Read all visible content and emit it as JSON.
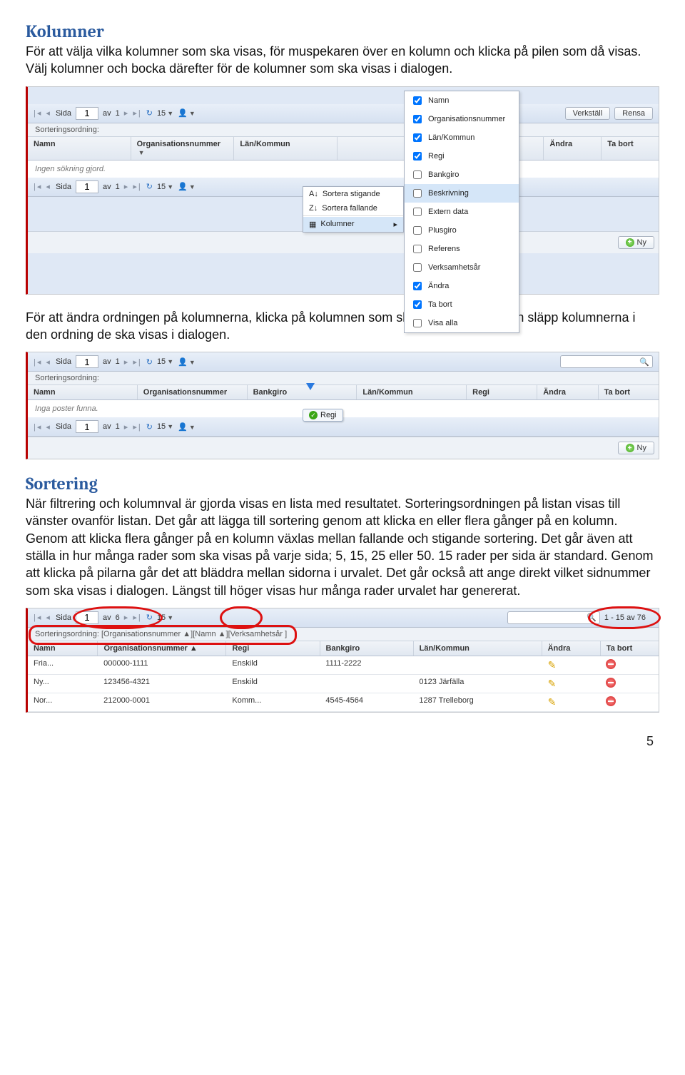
{
  "pageNumber": "5",
  "sections": {
    "kolumner": {
      "title": "Kolumner",
      "para": "För att välja vilka kolumner som ska visas, för muspekaren över en kolumn och klicka på pilen som då visas. Välj kolumner och bocka därefter för de kolumner som ska visas i dialogen."
    },
    "ordering": {
      "para": "För att ändra ordningen på kolumnerna, klicka på kolumnen som ska flyttas och dra och släpp kolumnerna i den ordning de ska visas i dialogen."
    },
    "sortering": {
      "title": "Sortering",
      "para": "När filtrering och kolumnval är gjorda visas en lista med resultatet. Sorteringsordningen på listan visas till vänster ovanför listan. Det går att lägga till sortering genom att klicka en eller flera gånger på en kolumn. Genom att klicka flera gånger på en kolumn växlas mellan fallande och stigande sortering. Det går även att ställa in hur många rader som ska visas på varje sida; 5, 15, 25 eller 50. 15 rader per sida är standard. Genom att klicka på pilarna går det att bläddra mellan sidorna i urvalet. Det går också att ange direkt vilket sidnummer som ska visas i dialogen. Längst till höger visas hur många rader urvalet har genererat."
    }
  },
  "common": {
    "sida": "Sida",
    "av": "av",
    "perPage": "15",
    "sorteringsordning": "Sorteringsordning:",
    "verkstall": "Verkställ",
    "rensa": "Rensa",
    "ny": "Ny",
    "searchPlaceholder": ""
  },
  "shot1": {
    "pageVal": "1",
    "pageTotal": "1",
    "columns": [
      "Namn",
      "Organisationsnummer",
      "Län/Kommun",
      "",
      "",
      "Ändra",
      "Ta bort"
    ],
    "contextMenu": {
      "sortAsc": "Sortera stigande",
      "sortDesc": "Sortera fallande",
      "kolumner": "Kolumner"
    },
    "columnPicker": [
      {
        "label": "Namn",
        "checked": true
      },
      {
        "label": "Organisationsnummer",
        "checked": true
      },
      {
        "label": "Län/Kommun",
        "checked": true
      },
      {
        "label": "Regi",
        "checked": true
      },
      {
        "label": "Bankgiro",
        "checked": false
      },
      {
        "label": "Beskrivning",
        "checked": false,
        "hl": true
      },
      {
        "label": "Extern data",
        "checked": false
      },
      {
        "label": "Plusgiro",
        "checked": false
      },
      {
        "label": "Referens",
        "checked": false
      },
      {
        "label": "Verksamhetsår",
        "checked": false
      },
      {
        "label": "Ändra",
        "checked": true
      },
      {
        "label": "Ta bort",
        "checked": true
      },
      {
        "label": "Visa alla",
        "checked": false
      }
    ],
    "emptyMsg": "Ingen sökning gjord."
  },
  "shot2": {
    "pageVal": "1",
    "pageTotal": "1",
    "columns": [
      "Namn",
      "Organisationsnummer",
      "Bankgiro",
      "Län/Kommun",
      "Regi",
      "Ändra",
      "Ta bort"
    ],
    "dragLabel": "Regi",
    "emptyMsg": "Inga poster funna."
  },
  "shot3": {
    "pageVal": "1",
    "pageTotal": "6",
    "range": "1 - 15 av 76",
    "sortBreadcrumb": "Sorteringsordning: [Organisationsnummer ▲][Namn ▲][Verksamhetsår ]",
    "columns": [
      "Namn",
      "Organisationsnummer",
      "Regi",
      "Bankgiro",
      "Län/Kommun",
      "Ändra",
      "Ta bort"
    ],
    "rows": [
      {
        "namn": "Fria...",
        "org": "000000-1111",
        "regi": "Enskild",
        "bank": "1111-2222",
        "lan": ""
      },
      {
        "namn": "Ny...",
        "org": "123456-4321",
        "regi": "Enskild",
        "bank": "",
        "lan": "0123 Järfälla"
      },
      {
        "namn": "Nor...",
        "org": "212000-0001",
        "regi": "Komm...",
        "bank": "4545-4564",
        "lan": "1287 Trelleborg"
      }
    ]
  }
}
